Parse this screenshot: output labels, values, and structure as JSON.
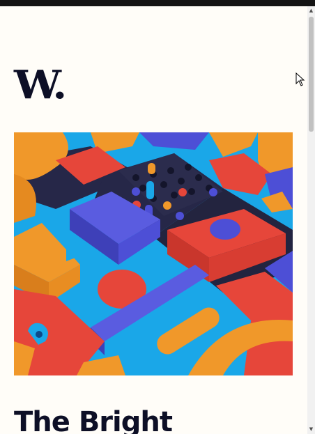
{
  "brand": {
    "logo_text": "W."
  },
  "article": {
    "title": "The Bright"
  },
  "hero_image": {
    "alt": "",
    "colors": {
      "sky": "#1aa7e8",
      "orange": "#f0982a",
      "red": "#e6463a",
      "indigo": "#4d4fd6",
      "navy": "#262748"
    }
  },
  "scrollbar": {
    "up_glyph": "▲",
    "down_glyph": "▼"
  }
}
